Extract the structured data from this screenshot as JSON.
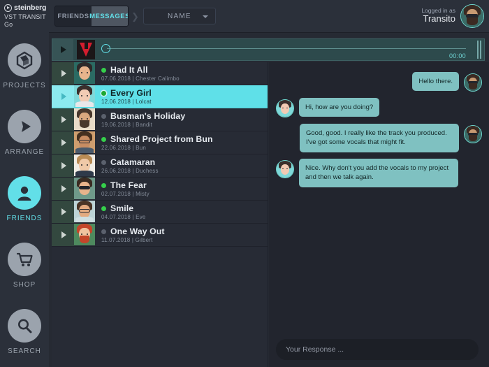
{
  "brand": {
    "name": "steinberg",
    "product": "VST TRANSIT Go",
    "logo_icon": "play-circle-icon"
  },
  "header": {
    "tabs": [
      {
        "label": "FRIENDS",
        "active": false
      },
      {
        "label": "MESSAGES",
        "active": true
      }
    ],
    "chevron_icon": "chevron-right-icon",
    "filter": {
      "label": "NAME",
      "caret_icon": "chevron-down-icon"
    },
    "user": {
      "logged_in_label": "Logged in as",
      "name": "Transito",
      "avatar_icon": "user-avatar"
    }
  },
  "sidebar": {
    "items": [
      {
        "label": "PROJECTS",
        "icon": "cube-icon",
        "active": false
      },
      {
        "label": "ARRANGE",
        "icon": "play-icon",
        "active": false
      },
      {
        "label": "FRIENDS",
        "icon": "person-icon",
        "active": true
      },
      {
        "label": "SHOP",
        "icon": "cart-icon",
        "active": false
      },
      {
        "label": "SEARCH",
        "icon": "magnifier-icon",
        "active": false
      }
    ]
  },
  "player": {
    "play_icon": "play-icon",
    "artwork_label": "V",
    "timecode": "00:00",
    "progress_percent": 0,
    "end_icon": "pause-bars-icon"
  },
  "tracks": [
    {
      "title": "Had It All",
      "date": "07.06.2018",
      "author": "Chester Calimbo",
      "status": "online",
      "selected": false,
      "go_icon": "chevron-right-icon"
    },
    {
      "title": "Every Girl",
      "date": "12.06.2018",
      "author": "Lolcat",
      "status": "online",
      "selected": true,
      "go_icon": "chevron-right-icon"
    },
    {
      "title": "Busman's Holiday",
      "date": "19.06.2018",
      "author": "Bandit",
      "status": "offline",
      "selected": false,
      "go_icon": "chevron-right-icon"
    },
    {
      "title": "Shared Project from Bun",
      "date": "22.06.2018",
      "author": "Bun",
      "status": "online",
      "selected": false,
      "go_icon": "chevron-right-icon"
    },
    {
      "title": "Catamaran",
      "date": "26.06.2018",
      "author": "Duchess",
      "status": "offline",
      "selected": false,
      "go_icon": "chevron-right-icon"
    },
    {
      "title": "The Fear",
      "date": "02.07.2018",
      "author": "Misty",
      "status": "online",
      "selected": false,
      "go_icon": "chevron-right-icon"
    },
    {
      "title": "Smile",
      "date": "04.07.2018",
      "author": "Eve",
      "status": "online",
      "selected": false,
      "go_icon": "chevron-right-icon"
    },
    {
      "title": "One Way Out",
      "date": "11.07.2018",
      "author": "Gilbert",
      "status": "offline",
      "selected": false,
      "go_icon": "chevron-right-icon"
    }
  ],
  "chat": {
    "messages": [
      {
        "side": "me",
        "text": "Hello there.",
        "avatar_icon": "user-avatar-transito"
      },
      {
        "side": "them",
        "text": "Hi, how are you doing?",
        "avatar_icon": "user-avatar-lolcat"
      },
      {
        "side": "me",
        "text": "Good, good. I really like the track you produced. I've got some vocals that might fit.",
        "avatar_icon": "user-avatar-transito"
      },
      {
        "side": "them",
        "text": "Nice. Why don't you add the vocals to my project and then we talk again.",
        "avatar_icon": "user-avatar-lolcat"
      }
    ],
    "composer": {
      "value": "",
      "placeholder": "Your Response ..."
    }
  },
  "colors": {
    "accent_cyan": "#62dfe8",
    "selected_row": "#5fe0e8",
    "bubble": "#7fc1c1",
    "online": "#35cf4b",
    "offline": "#5b616d",
    "panel_bg": "#272b35",
    "chat_bg": "#22252e",
    "chrome": "#2b303a",
    "player_bg": "#2d4a4c",
    "artwork_red": "#d41d2e"
  }
}
